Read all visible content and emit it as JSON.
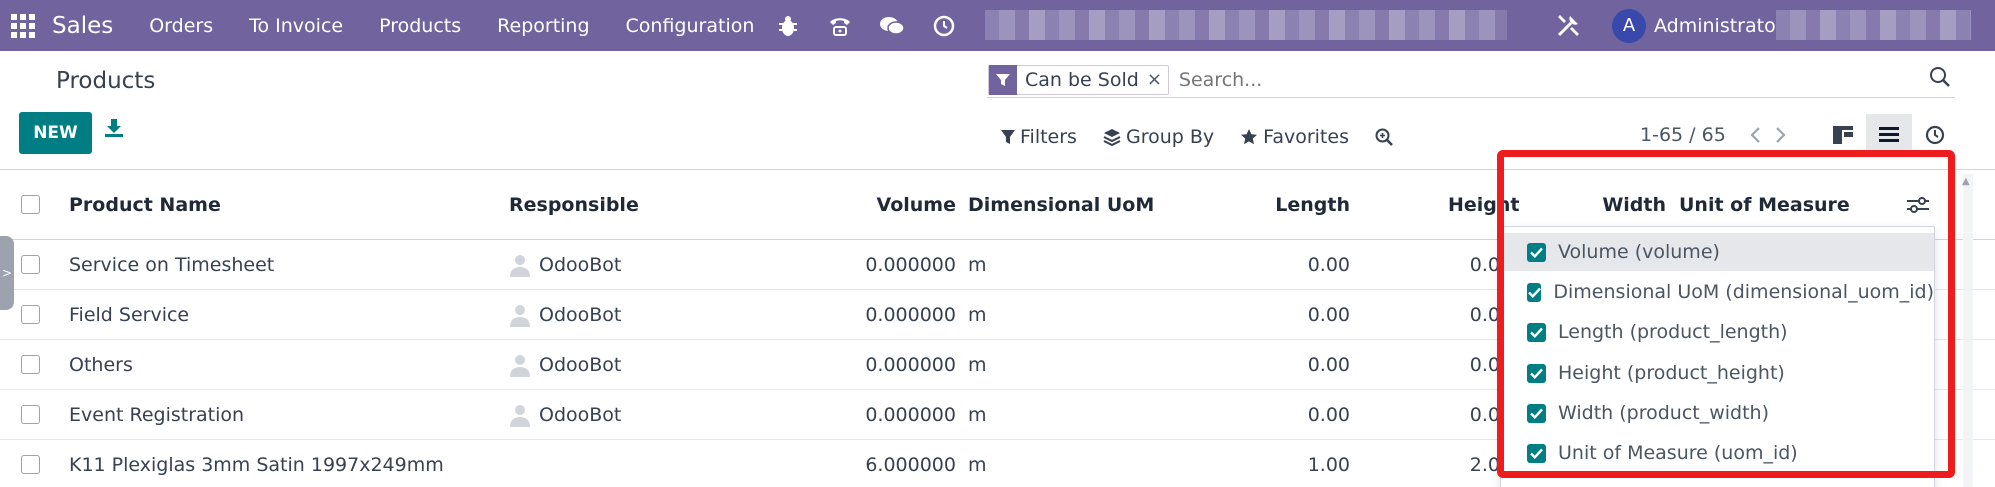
{
  "navbar": {
    "brand": "Sales",
    "menus": [
      "Orders",
      "To Invoice",
      "Products",
      "Reporting",
      "Configuration"
    ],
    "user": {
      "initial": "A",
      "name": "Administrator"
    }
  },
  "page": {
    "title": "Products"
  },
  "buttons": {
    "new_label": "NEW"
  },
  "search": {
    "facet_label": "Can be Sold",
    "facet_remove": "×",
    "placeholder": "Search..."
  },
  "filters": {
    "filters_label": "Filters",
    "group_by_label": "Group By",
    "favorites_label": "Favorites"
  },
  "pager": {
    "value": "1-65 / 65"
  },
  "table": {
    "columns": {
      "product_name": "Product Name",
      "responsible": "Responsible",
      "volume": "Volume",
      "dimensional_uom": "Dimensional UoM",
      "length": "Length",
      "height": "Height",
      "width": "Width",
      "unit_of_measure": "Unit of Measure"
    },
    "rows": [
      {
        "name": "Service on Timesheet",
        "responsible": "OdooBot",
        "volume": "0.000000",
        "uom": "m",
        "length": "0.00",
        "height": "0.0"
      },
      {
        "name": "Field Service",
        "responsible": "OdooBot",
        "volume": "0.000000",
        "uom": "m",
        "length": "0.00",
        "height": "0.0"
      },
      {
        "name": "Others",
        "responsible": "OdooBot",
        "volume": "0.000000",
        "uom": "m",
        "length": "0.00",
        "height": "0.0"
      },
      {
        "name": "Event Registration",
        "responsible": "OdooBot",
        "volume": "0.000000",
        "uom": "m",
        "length": "0.00",
        "height": "0.0"
      },
      {
        "name": "K11 Plexiglas 3mm Satin 1997x249mm",
        "responsible": "",
        "volume": "6.000000",
        "uom": "m",
        "length": "1.00",
        "height": "2.0"
      }
    ]
  },
  "optional_columns": {
    "items": [
      {
        "label": "Volume (volume)",
        "checked": true
      },
      {
        "label": "Dimensional UoM (dimensional_uom_id)",
        "checked": true
      },
      {
        "label": "Length (product_length)",
        "checked": true
      },
      {
        "label": "Height (product_height)",
        "checked": true
      },
      {
        "label": "Width (product_width)",
        "checked": true
      },
      {
        "label": "Unit of Measure (uom_id)",
        "checked": true
      }
    ]
  },
  "colors": {
    "navbar": "#71639e",
    "primary": "#017e84",
    "highlight": "#ee1c1c",
    "avatar": "#3949ab"
  },
  "icons": {
    "apps": "apps-grid-icon",
    "bug": "bug-icon",
    "phone": "phone-icon",
    "chat": "chat-icon",
    "clock": "clock-icon",
    "tools": "tools-icon",
    "download": "download-icon",
    "filter": "filter-icon",
    "group": "layers-icon",
    "star": "star-icon",
    "zoom": "zoom-icon",
    "kanban": "kanban-view-icon",
    "list": "list-view-icon",
    "activity": "activity-view-icon",
    "settings": "optional-columns-toggle-icon"
  }
}
